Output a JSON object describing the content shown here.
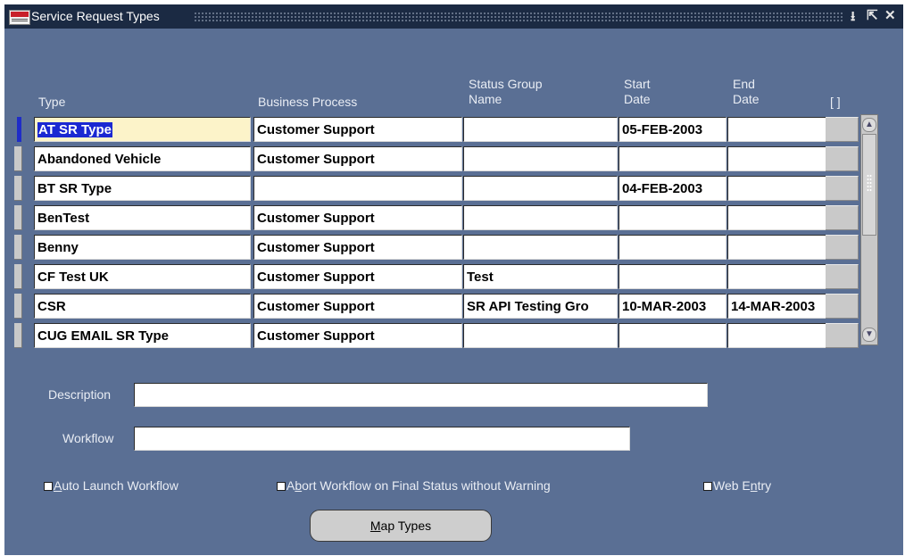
{
  "window": {
    "title": "Service Request Types",
    "controls": [
      "minimize-icon",
      "maximize-icon",
      "close-icon"
    ]
  },
  "table": {
    "headers": {
      "type": "Type",
      "business_process": "Business Process",
      "status_group_line1": "Status Group",
      "status_group_line2": "Name",
      "start_line1": "Start",
      "start_line2": "Date",
      "end_line1": "End",
      "end_line2": "Date",
      "dff": "[ ]"
    },
    "rows": [
      {
        "type": "AT SR Type",
        "business_process": "Customer Support",
        "status_group": "",
        "start_date": "05-FEB-2003",
        "end_date": ""
      },
      {
        "type": "Abandoned Vehicle",
        "business_process": "Customer Support",
        "status_group": "",
        "start_date": "",
        "end_date": ""
      },
      {
        "type": "BT SR Type",
        "business_process": "",
        "status_group": "",
        "start_date": "04-FEB-2003",
        "end_date": ""
      },
      {
        "type": "BenTest",
        "business_process": "Customer Support",
        "status_group": "",
        "start_date": "",
        "end_date": ""
      },
      {
        "type": "Benny",
        "business_process": "Customer Support",
        "status_group": "",
        "start_date": "",
        "end_date": ""
      },
      {
        "type": "CF Test UK",
        "business_process": "Customer Support",
        "status_group": "Test",
        "start_date": "",
        "end_date": ""
      },
      {
        "type": "CSR",
        "business_process": "Customer Support",
        "status_group": "SR API Testing Gro",
        "start_date": "10-MAR-2003",
        "end_date": "14-MAR-2003"
      },
      {
        "type": "CUG EMAIL SR Type",
        "business_process": "Customer Support",
        "status_group": "",
        "start_date": "",
        "end_date": ""
      }
    ]
  },
  "fields": {
    "description_label": "Description",
    "description_value": "",
    "workflow_label": "Workflow",
    "workflow_value": ""
  },
  "checkboxes": {
    "auto_launch": {
      "mnemonic": "A",
      "rest": "uto Launch Workflow",
      "checked": false
    },
    "abort_workflow": {
      "pre": "A",
      "mnemonic": "b",
      "rest": "ort Workflow on Final Status without Warning",
      "checked": false
    },
    "web_entry": {
      "pre": "Web E",
      "mnemonic": "n",
      "rest": "try",
      "checked": false
    }
  },
  "buttons": {
    "map_types": {
      "mnemonic": "M",
      "rest": "ap Types"
    }
  },
  "colors": {
    "window_bg": "#5a6f94",
    "titlebar": "#1b2a43",
    "current_cell": "#fcf3c9",
    "selection": "#1b28d2"
  }
}
